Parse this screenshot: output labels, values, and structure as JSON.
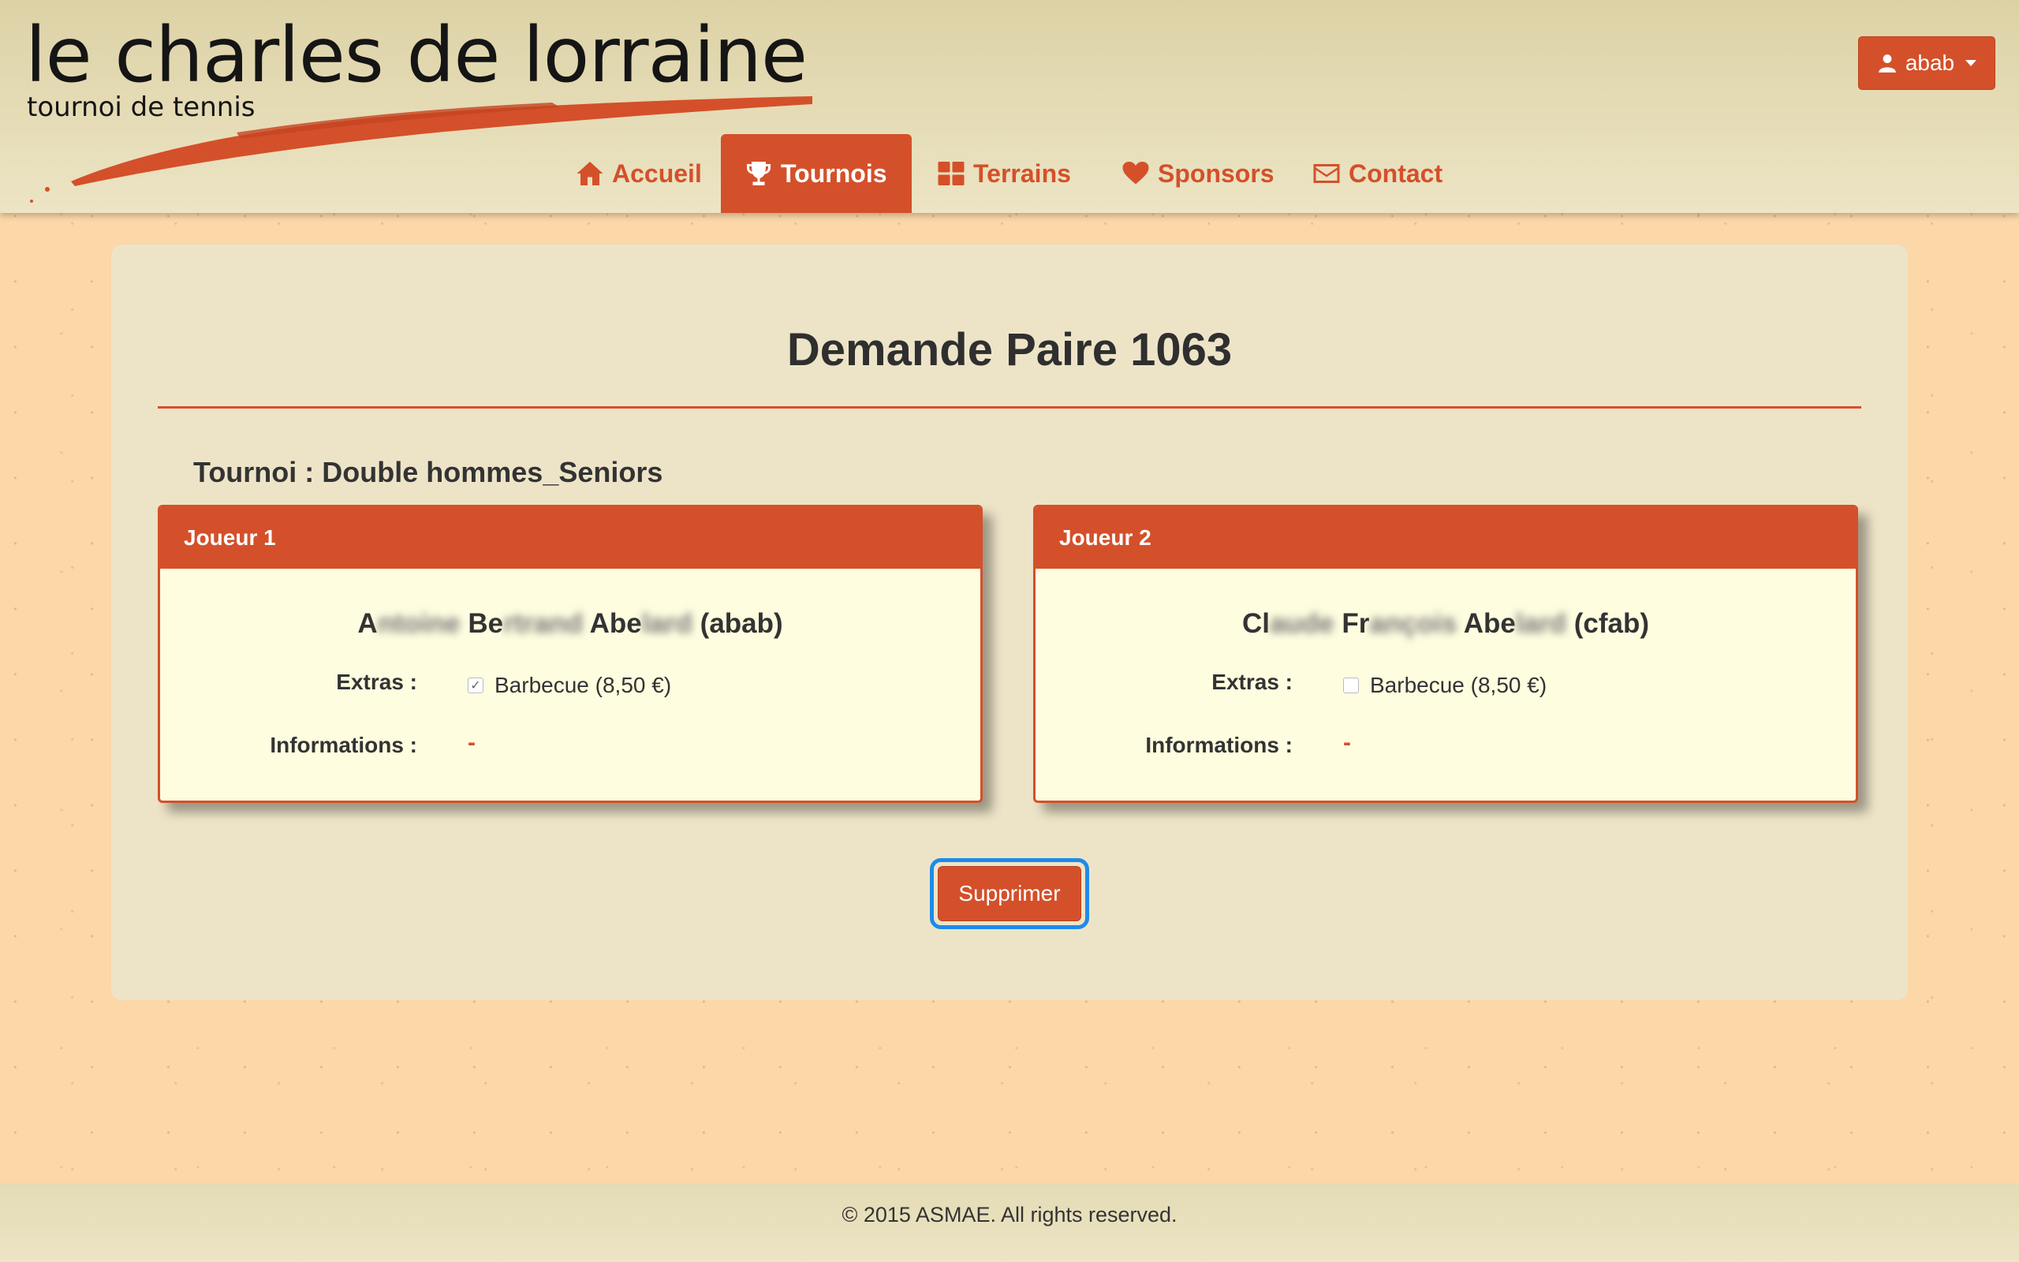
{
  "header": {
    "logo_title": "le charles de lorraine",
    "logo_subtitle": "tournoi de tennis",
    "user_menu_label": "abab"
  },
  "nav": [
    {
      "label": "Accueil",
      "icon": "home-icon"
    },
    {
      "label": "Tournois",
      "icon": "trophy-icon",
      "active": true
    },
    {
      "label": "Terrains",
      "icon": "grid-icon"
    },
    {
      "label": "Sponsors",
      "icon": "heart-icon"
    },
    {
      "label": "Contact",
      "icon": "envelope-icon"
    }
  ],
  "main": {
    "title": "Demande Paire 1063",
    "tournoi_label": "Tournoi : Double hommes_Seniors",
    "players": [
      {
        "header": "Joueur 1",
        "name_parts": [
          "A",
          "ntoine",
          " Be",
          "rtrand",
          " Abe",
          "lard",
          " (abab)"
        ],
        "extras_label": "Extras :",
        "extras_item": "Barbecue (8,50 €)",
        "extras_checked": true,
        "infos_label": "Informations :",
        "infos_value": "-"
      },
      {
        "header": "Joueur 2",
        "name_parts": [
          "Cl",
          "aude",
          " Fr",
          "ançois",
          " Abe",
          "lard",
          " (cfab)"
        ],
        "extras_label": "Extras :",
        "extras_item": "Barbecue (8,50 €)",
        "extras_checked": false,
        "infos_label": "Informations :",
        "infos_value": "-"
      }
    ],
    "delete_label": "Supprimer"
  },
  "footer": {
    "copyright": "© 2015 ASMAE. All rights reserved."
  },
  "colors": {
    "accent": "#d4502a",
    "background": "#fcd7a8",
    "panel": "#ede4c8",
    "card": "#fffde0",
    "focus": "#1e8bea"
  }
}
